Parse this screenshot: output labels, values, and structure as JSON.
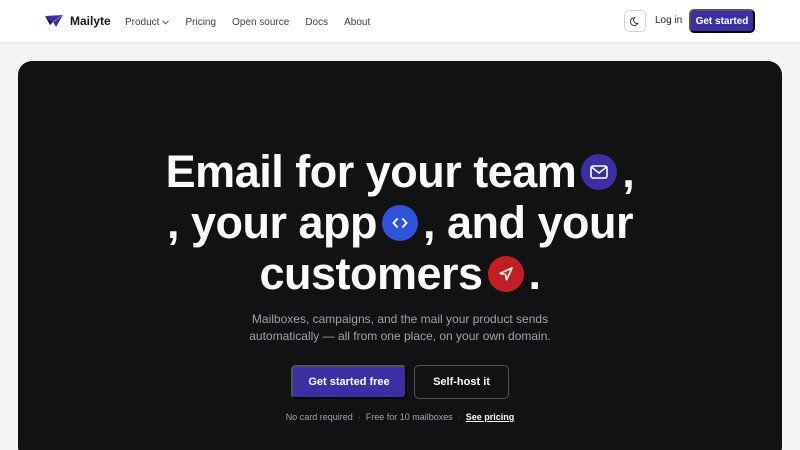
{
  "brand": {
    "name": "Mailyte",
    "icon": "paper-plane-logo-icon"
  },
  "nav": {
    "links": [
      {
        "label": "Product",
        "has_dropdown": true
      },
      {
        "label": "Pricing"
      },
      {
        "label": "Open source"
      },
      {
        "label": "Docs"
      },
      {
        "label": "About"
      }
    ],
    "theme_icon": "moon-icon",
    "login_label": "Log in",
    "cta_label": "Get started"
  },
  "hero": {
    "line1": "Email for your team",
    "line1_end": ",",
    "line2": ", your app",
    "line2_end": ", and your",
    "line3": "customers",
    "line3_end": ".",
    "badges": [
      {
        "icon": "envelope-icon",
        "color": "#3b2fa3"
      },
      {
        "icon": "code-brackets-icon",
        "color": "#2f54d9"
      },
      {
        "icon": "send-arrow-icon",
        "color": "#c21f24"
      }
    ],
    "subtitle_line1": "Mailboxes, campaigns, and the mail your product sends",
    "subtitle_line2": "automatically — all from one place, on your own domain.",
    "primary_cta": "Get started free",
    "secondary_cta": "Self-host it",
    "meta": {
      "item1": "No card required",
      "item2": "Free for 10 mailboxes",
      "link": "See pricing",
      "separator": "·"
    }
  },
  "colors": {
    "accent": "#3b2fa3",
    "hero_bg": "#121215",
    "page_bg": "#f4f4f5"
  }
}
